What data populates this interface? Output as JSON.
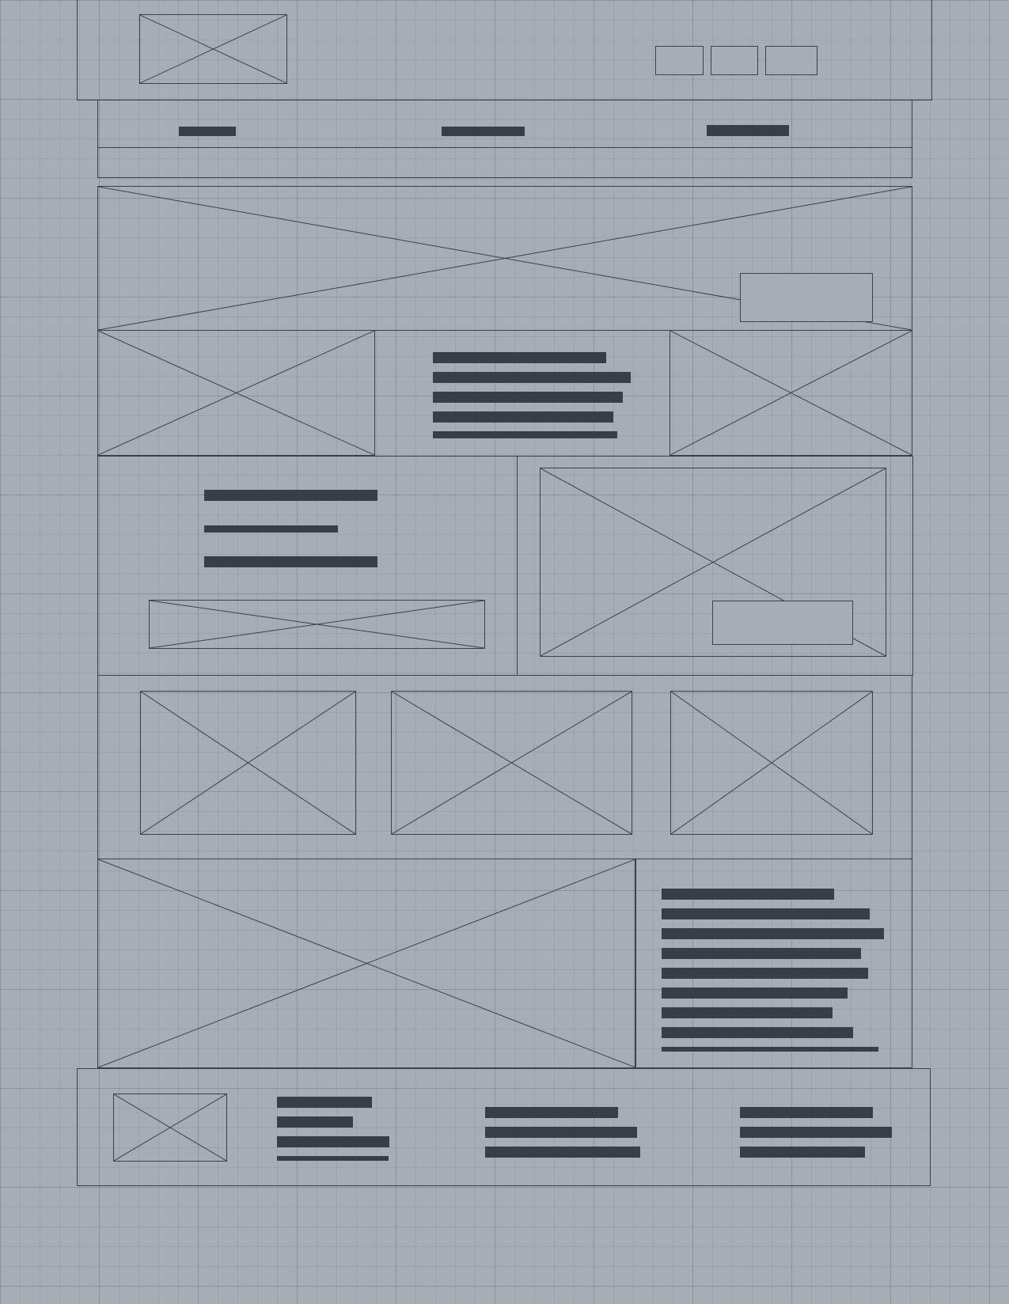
{
  "colors": {
    "background": "#a6adb5",
    "stroke": "#39414a",
    "text_bar": "#363e47"
  },
  "elements": {
    "header_logo": "image-placeholder",
    "nav_buttons": 3,
    "menu_items": 3,
    "hero": "image-placeholder",
    "gallery_items": 3,
    "footer_columns": 4
  }
}
